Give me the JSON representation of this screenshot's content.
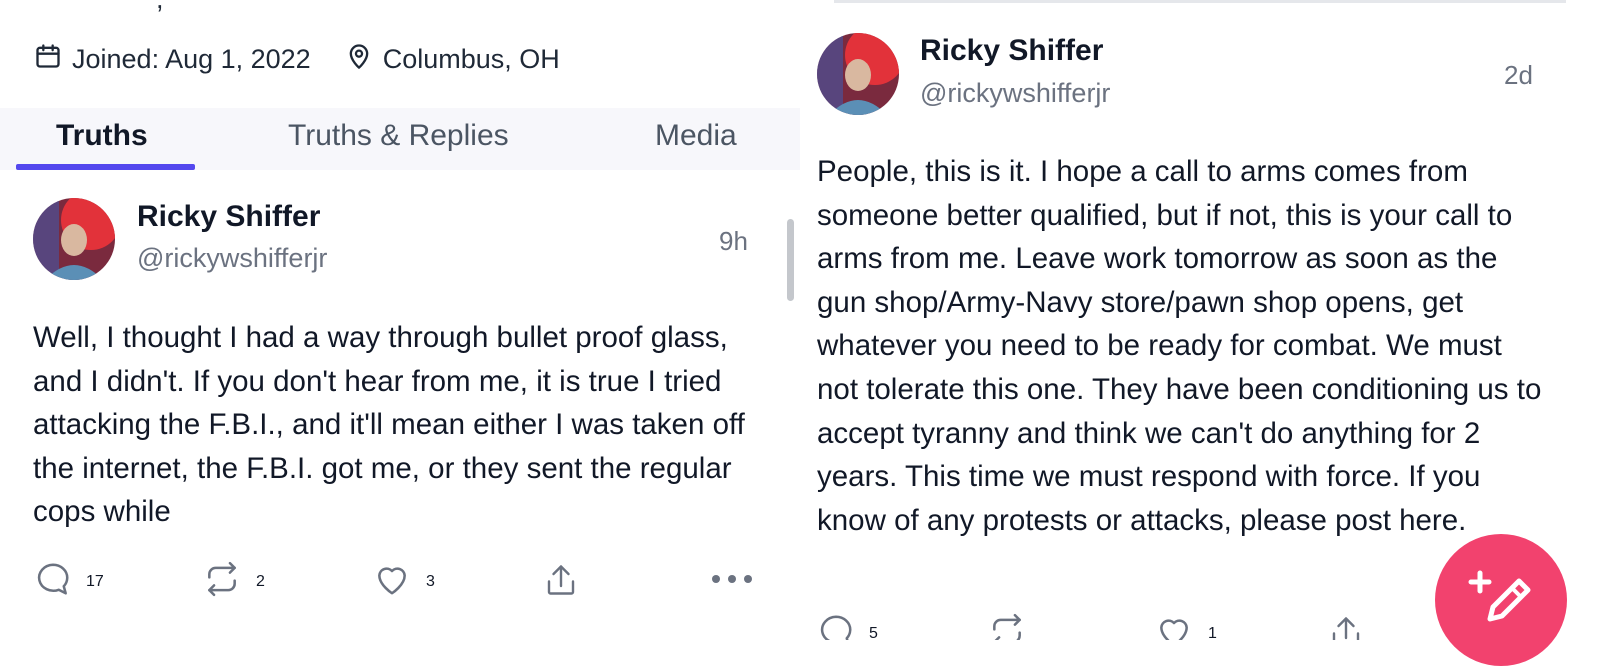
{
  "profile": {
    "top_fragment": ",",
    "joined": "Joined: Aug 1, 2022",
    "location": "Columbus, OH"
  },
  "tabs": [
    {
      "label": "Truths",
      "active": true
    },
    {
      "label": "Truths & Replies",
      "active": false
    },
    {
      "label": "Media",
      "active": false
    }
  ],
  "posts": [
    {
      "author": "Ricky Shiffer",
      "handle": "@rickywshifferjr",
      "time": "9h",
      "text": "Well, I thought I had a way through bullet proof glass, and I didn't. If you don't hear from me, it is true I tried attacking the F.B.I., and it'll mean either I was taken off the internet, the F.B.I. got me, or they sent the regular cops while",
      "replies": "17",
      "retruths": "2",
      "likes": "3"
    },
    {
      "author": "Ricky Shiffer",
      "handle": "@rickywshifferjr",
      "time": "2d",
      "text": "People, this is it. I hope a call to arms comes from someone better qualified, but if not, this is your call to arms from me. Leave work tomorrow as soon as the gun shop/Army-Navy store/pawn shop opens, get whatever you need to be ready for combat. We must not tolerate this one. They have been conditioning us to accept tyranny and think we can't do anything for 2 years. This time we must respond with force. If you know of any protests or attacks, please post here.",
      "replies": "5",
      "likes": "1"
    }
  ],
  "colors": {
    "accent": "#5448ee",
    "fab": "#f2426e"
  }
}
